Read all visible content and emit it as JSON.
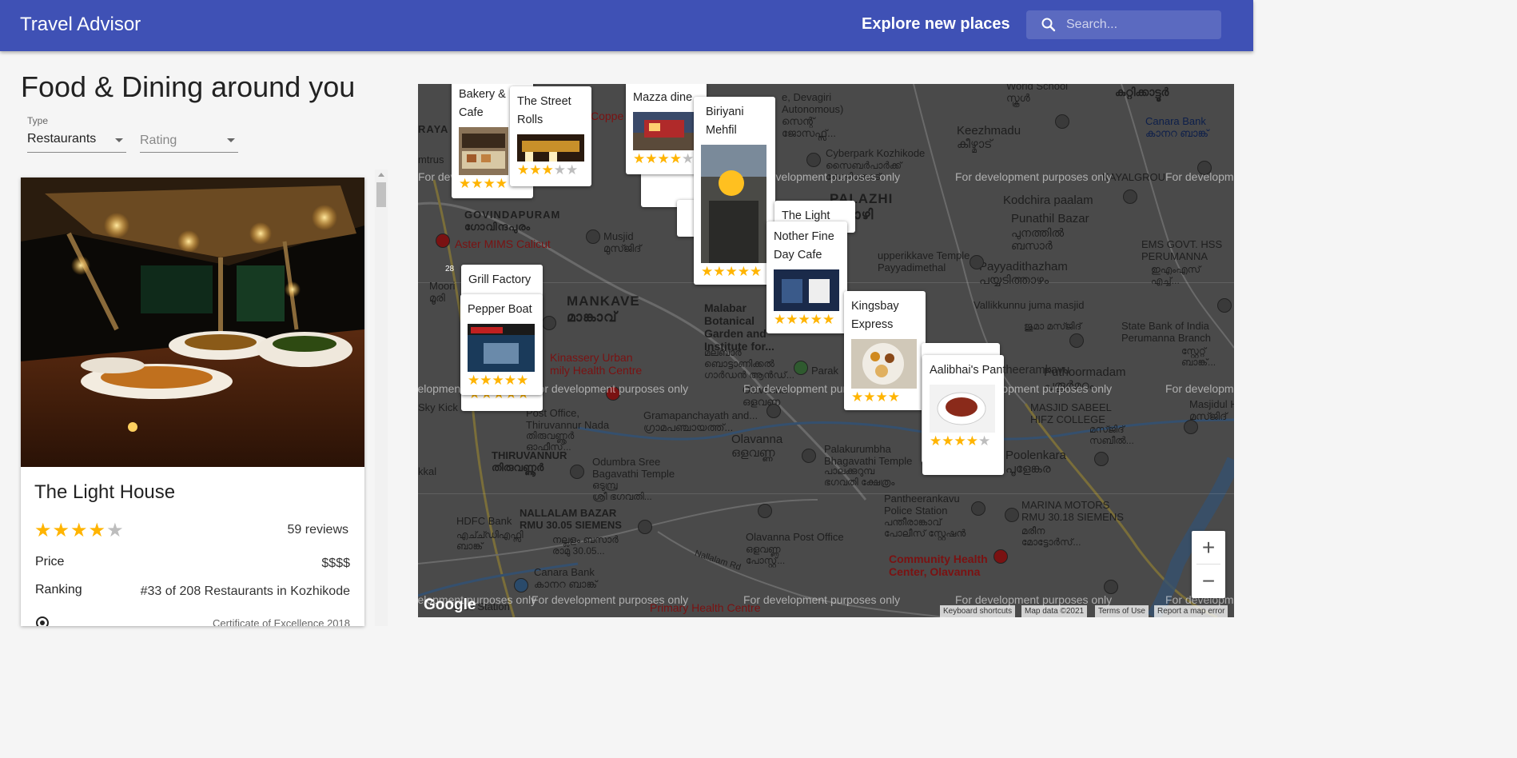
{
  "app": {
    "title": "Travel Advisor",
    "explore_label": "Explore new places",
    "search_placeholder": "Search...",
    "search_icon": "search-icon"
  },
  "filters": {
    "heading": "Food & Dining around you",
    "type_label": "Type",
    "type_value": "Restaurants",
    "rating_placeholder": "Rating"
  },
  "card": {
    "name": "The Light House",
    "rating": 4,
    "stars": "★★★★",
    "stars_off": "★",
    "reviews": "59 reviews",
    "rows": [
      {
        "label": "Price",
        "value": "$$$$"
      },
      {
        "label": "Ranking",
        "value": "#33 of 208 Restaurants in Kozhikode"
      }
    ],
    "award": "Certificate of Excellence 2018",
    "award_icon": "award-icon",
    "photo_icon": "restaurant-photo"
  },
  "map": {
    "watermark": "For development purposes only",
    "google": "Google",
    "zoom_in": "+",
    "zoom_out": "−",
    "attribution": [
      "Keyboard shortcuts",
      "Map data ©2021",
      "Terms of Use",
      "Report a map error"
    ],
    "labels": {
      "govindapuram": "GOVINDAPURAM",
      "govindapuram_ml": "ഗോവിന്ദപുരം",
      "aster": "Aster MIMS Calicut",
      "musjid": "Musjid",
      "musjid_ml": "മുസ്ജിദ്",
      "mankave": "MANKAVE",
      "mankave_ml": "മാങ്കാവ്",
      "malabar": "Malabar\nBotanical\nGarden and\nInstitute for...",
      "malabar_ml": "മലബാർ\nബൊട്ടാണിക്കൽ\nഗാർഡൻ ആൻഡ്...",
      "kinassery": "Kinassery Urban\nmily Health Centre",
      "skykick": "Sky Kick",
      "postoffice": "Post Office,\nThiruvannur Nada",
      "postoffice_ml": "തിരുവണ്ണൂർ\nഓഫീസ്...",
      "gramapanchayath": "Gramapanchayath and...",
      "gramapanchayath_ml": "ഗ്രാമപഞ്ചായത്ത്...",
      "thiruvannur": "THIRUVANNUR",
      "thiruvannur_ml": "തിരുവണ്ണൂർ",
      "odumbra": "Odumbra Sree\nBagavathi Temple",
      "odumbra_ml": "ഒടുമ്പ്ര\nശ്രീ ഭഗവതി...",
      "olavanna": "Olavanna",
      "olavanna_ml": "ഒളവണ്ണ",
      "olavanna2": "Olavanna",
      "olavanna2_ml": "ഒളവണ്ണ",
      "palakurumba": "Palakurumbha\nBhagavathi Temple",
      "palakurumba_ml": "പാലക്കുറുമ്പ\nഭഗവതി ക്ഷേത്രം",
      "hdfc": "HDFC Bank",
      "hdfc_ml": "എച്ച്ഡിഎഫ്സി\nബാങ്ക്",
      "nallalam": "NALLALAM BAZAR\nRMU 30.05 SIEMENS",
      "nallalam_ml": "നല്ലളം ബസാർ\nരാമു 30.05...",
      "olavanna_po": "Olavanna Post Office",
      "olavanna_po_ml": "ഒളവണ്ണ\nപോസ്റ്റ്...",
      "nallalam_rd": "Nallalam Rd",
      "canara2": "Canara Bank",
      "canara2_ml": "കാനറ ബാങ്ക്",
      "police_station": "olice Station",
      "primary_health": "Primary Health Centre",
      "community_health": "Community Health\nCenter, Olavanna",
      "pantheerankavu_ps": "Pantheerankavu\nPolice Station",
      "pantheerankavu_ps_ml": "പന്തീരാങ്കാവ്\nപോലീസ് സ്റ്റേഷൻ",
      "marina": "MARINA MOTORS\nRMU 30.18 SIEMENS",
      "marina_ml": "മരീന\nമോട്ടോർസ്...",
      "poolenkara": "Poolenkara",
      "poolenkara_ml": "പൂളേങ്കര",
      "puthoormadam": "Puthoormadam",
      "puthoormadam_ml": "പുതൂർമഠം",
      "masjid_sabeel": "MASJID SABEEL\nHIFZ COLLEGE",
      "masjid_sabeel_ml": "മസ്ജിദ്\nസബീൽ...",
      "state_bank": "State Bank of India\nPerumanna Branch",
      "state_bank_ml": "സ്റ്റേറ്റ്\nബാങ്ക്...",
      "vallikkunnu": "Vallikkunnu juma masjid",
      "vallikkunnu_ml": "ജുമാ മസ്ജിദ്",
      "payyadi": "Payyadithazham",
      "payyadi_ml": "പയ്യടിത്താഴം",
      "ems": "EMS GOVT. HSS\nPERUMANNA",
      "ems_ml": "ഇഎംഎസ്\nഎച്ച്...",
      "punathil": "Punathil Bazar",
      "punathil_ml": "പുനത്തിൽ\nബസാർ",
      "kodchira": "Kodchira paalam",
      "palazhi": "PALAZHI",
      "palazhi_ml": "പലാഴി",
      "cyberpark": "Cyberpark Kozhikode",
      "cyberpark_ml": "സൈബർപാർക്ക്\nകോഴിക്കോട്",
      "keezhmadu": "Keezhmadu",
      "keezhmadu_ml": "കീഴ്മാട്",
      "canara": "Canara Bank",
      "canara_ml": "കാനറ ബാങ്ക്",
      "world_school": "World School",
      "world_school_ml": "സ്കൂൾ",
      "kuttikattoor": "കുറ്റിക്കാട്ടൂർ",
      "devagiri": "e, Devagiri\nAutonomous)\nസെന്റ്\nജോസഫ്സ്...",
      "upperkikkave": "upperikkave Temple,\nPayyadimethal",
      "kayalgrou": "KAYALGROU",
      "parak": "Parak",
      "moori": "Moori",
      "moori_ml": "മൂരി",
      "road28": "28",
      "koppe": "Coppe",
      "kkal": "kkal",
      "raya": "RAYA",
      "nsmudu": "mtrus",
      "masjid_huda": "Masjidul Hu",
      "masjid_huda_ml": "മസ്ജിദ്"
    }
  },
  "markers": [
    {
      "name": "Bakery & Cafe",
      "rating": 4,
      "stars": "★★★★",
      "photo": "bakery-photo"
    },
    {
      "name": "The Street Rolls",
      "rating": 3,
      "stars": "★★★",
      "stars_off": "★★",
      "photo": "street-rolls-photo"
    },
    {
      "name": "Mazza dine",
      "rating": 4,
      "stars": "★★★★",
      "stars_off": "★",
      "photo": "mazza-photo"
    },
    {
      "name": "Biriyani Mehfil",
      "rating": 5,
      "stars": "★★★★★",
      "photo": "biriyani-photo"
    },
    {
      "name": "The Light",
      "rating": 5
    },
    {
      "name": "Nother Fine Day Cafe",
      "rating": 5,
      "stars": "★★★★★",
      "photo": "nother-photo"
    },
    {
      "name": "Grill Factory",
      "rating": 5,
      "stars": "★★★★★"
    },
    {
      "name": "Pepper Boat",
      "rating": 5,
      "stars": "★★★★★",
      "photo": "pepper-boat-photo"
    },
    {
      "name": "Kingsbay Express",
      "rating": 4,
      "stars": "★★★★",
      "photo": "kingsbay-photo"
    },
    {
      "name": "Aalibhai's Pantheeramkavu",
      "rating": 4,
      "stars": "★★★★",
      "stars_off": "★",
      "photo": "aalibhai-photo"
    }
  ]
}
